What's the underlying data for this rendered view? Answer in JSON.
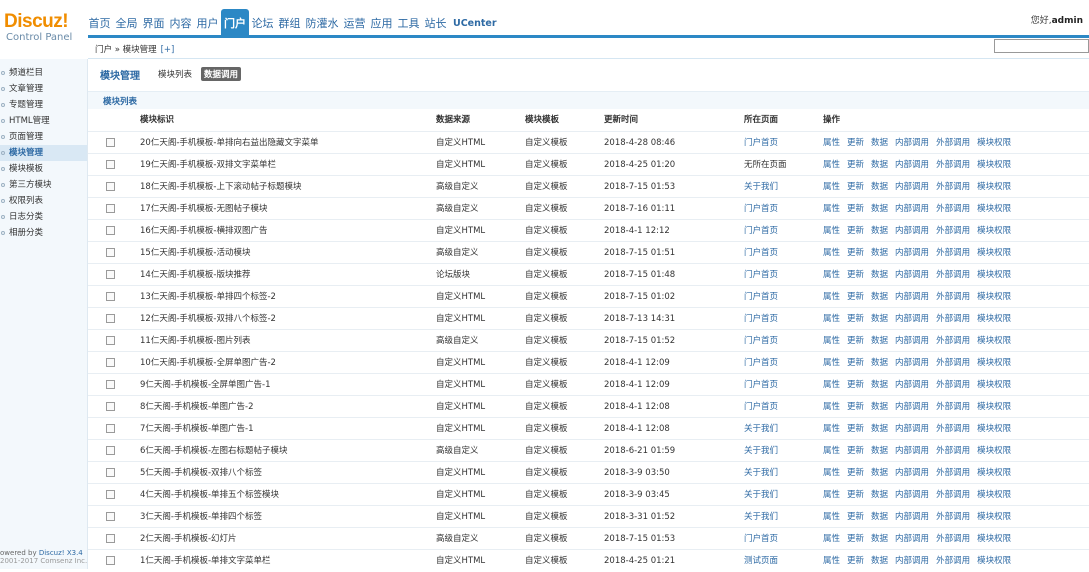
{
  "header": {
    "logo_text": "Discuz!",
    "logo_sub": "Control Panel",
    "greeting_prefix": "您好,",
    "greeting_user": "admin",
    "nav": [
      {
        "label": "首页",
        "active": false
      },
      {
        "label": "全局",
        "active": false
      },
      {
        "label": "界面",
        "active": false
      },
      {
        "label": "内容",
        "active": false
      },
      {
        "label": "用户",
        "active": false
      },
      {
        "label": "门户",
        "active": true
      },
      {
        "label": "论坛",
        "active": false
      },
      {
        "label": "群组",
        "active": false
      },
      {
        "label": "防灌水",
        "active": false
      },
      {
        "label": "运营",
        "active": false
      },
      {
        "label": "应用",
        "active": false
      },
      {
        "label": "工具",
        "active": false
      },
      {
        "label": "站长",
        "active": false
      },
      {
        "label": "UCenter",
        "active": false
      }
    ]
  },
  "breadcrumb": {
    "text": "门户 » 模块管理",
    "plus": "[+]"
  },
  "search": {
    "value": ""
  },
  "sidebar": {
    "items": [
      {
        "label": "频道栏目",
        "active": false
      },
      {
        "label": "文章管理",
        "active": false
      },
      {
        "label": "专题管理",
        "active": false
      },
      {
        "label": "HTML管理",
        "active": false
      },
      {
        "label": "页面管理",
        "active": false
      },
      {
        "label": "模块管理",
        "active": true
      },
      {
        "label": "模块模板",
        "active": false
      },
      {
        "label": "第三方模块",
        "active": false
      },
      {
        "label": "权限列表",
        "active": false
      },
      {
        "label": "日志分类",
        "active": false
      },
      {
        "label": "相册分类",
        "active": false
      }
    ],
    "footer_prefix": "owered by",
    "footer_brand": "Discuz! X3.4",
    "footer_line2": "2001-2017 Comsenz Inc."
  },
  "main": {
    "title": "模块管理",
    "tabs": [
      {
        "label": "模块列表",
        "current": false
      },
      {
        "label": "数据调用",
        "current": true
      }
    ],
    "list_title": "模块列表",
    "columns": [
      "模块标识",
      "数据来源",
      "模块模板",
      "更新时间",
      "所在页面",
      "操作"
    ],
    "operations": [
      "属性",
      "更新",
      "数据",
      "内部调用",
      "外部调用",
      "模块权限"
    ],
    "rows": [
      {
        "name": "20仁天阁-手机模板-单排向右益出隐藏文字菜单",
        "source": "自定义HTML",
        "template": "自定义模板",
        "time": "2018-4-28 08:46",
        "page": "门户首页",
        "page_link": true
      },
      {
        "name": "19仁天阁-手机模板-双排文字菜单栏",
        "source": "自定义HTML",
        "template": "自定义模板",
        "time": "2018-4-25 01:20",
        "page": "无所在页面",
        "page_link": false
      },
      {
        "name": "18仁天阁-手机模板-上下滚动帖子标题模块",
        "source": "高级自定义",
        "template": "自定义模板",
        "time": "2018-7-15 01:53",
        "page": "关于我们",
        "page_link": true
      },
      {
        "name": "17仁天阁-手机模板-无图帖子模块",
        "source": "高级自定义",
        "template": "自定义模板",
        "time": "2018-7-16 01:11",
        "page": "门户首页",
        "page_link": true
      },
      {
        "name": "16仁天阁-手机模板-横排双图广告",
        "source": "自定义HTML",
        "template": "自定义模板",
        "time": "2018-4-1 12:12",
        "page": "门户首页",
        "page_link": true
      },
      {
        "name": "15仁天阁-手机模板-活动模块",
        "source": "高级自定义",
        "template": "自定义模板",
        "time": "2018-7-15 01:51",
        "page": "门户首页",
        "page_link": true
      },
      {
        "name": "14仁天阁-手机模板-版块推荐",
        "source": "论坛版块",
        "template": "自定义模板",
        "time": "2018-7-15 01:48",
        "page": "门户首页",
        "page_link": true
      },
      {
        "name": "13仁天阁-手机模板-单排四个标签-2",
        "source": "自定义HTML",
        "template": "自定义模板",
        "time": "2018-7-15 01:02",
        "page": "门户首页",
        "page_link": true
      },
      {
        "name": "12仁天阁-手机模板-双排八个标签-2",
        "source": "自定义HTML",
        "template": "自定义模板",
        "time": "2018-7-13 14:31",
        "page": "门户首页",
        "page_link": true
      },
      {
        "name": "11仁天阁-手机模板-图片列表",
        "source": "高级自定义",
        "template": "自定义模板",
        "time": "2018-7-15 01:52",
        "page": "门户首页",
        "page_link": true
      },
      {
        "name": "10仁天阁-手机模板-全屏单图广告-2",
        "source": "自定义HTML",
        "template": "自定义模板",
        "time": "2018-4-1 12:09",
        "page": "门户首页",
        "page_link": true
      },
      {
        "name": "9仁天阁-手机模板-全屏单图广告-1",
        "source": "自定义HTML",
        "template": "自定义模板",
        "time": "2018-4-1 12:09",
        "page": "门户首页",
        "page_link": true
      },
      {
        "name": "8仁天阁-手机模板-单图广告-2",
        "source": "自定义HTML",
        "template": "自定义模板",
        "time": "2018-4-1 12:08",
        "page": "门户首页",
        "page_link": true
      },
      {
        "name": "7仁天阁-手机模板-单图广告-1",
        "source": "自定义HTML",
        "template": "自定义模板",
        "time": "2018-4-1 12:08",
        "page": "关于我们",
        "page_link": true
      },
      {
        "name": "6仁天阁-手机模板-左图右标题帖子模块",
        "source": "高级自定义",
        "template": "自定义模板",
        "time": "2018-6-21 01:59",
        "page": "关于我们",
        "page_link": true
      },
      {
        "name": "5仁天阁-手机模板-双排八个标签",
        "source": "自定义HTML",
        "template": "自定义模板",
        "time": "2018-3-9 03:50",
        "page": "关于我们",
        "page_link": true
      },
      {
        "name": "4仁天阁-手机模板-单排五个标签模块",
        "source": "自定义HTML",
        "template": "自定义模板",
        "time": "2018-3-9 03:45",
        "page": "关于我们",
        "page_link": true
      },
      {
        "name": "3仁天阁-手机模板-单排四个标签",
        "source": "自定义HTML",
        "template": "自定义模板",
        "time": "2018-3-31 01:52",
        "page": "关于我们",
        "page_link": true
      },
      {
        "name": "2仁天阁-手机模板-幻灯片",
        "source": "高级自定义",
        "template": "自定义模板",
        "time": "2018-7-15 01:53",
        "page": "门户首页",
        "page_link": true
      },
      {
        "name": "1仁天阁-手机模板-单排文字菜单栏",
        "source": "自定义HTML",
        "template": "自定义模板",
        "time": "2018-4-25 01:21",
        "page": "测试页面",
        "page_link": true
      }
    ]
  }
}
